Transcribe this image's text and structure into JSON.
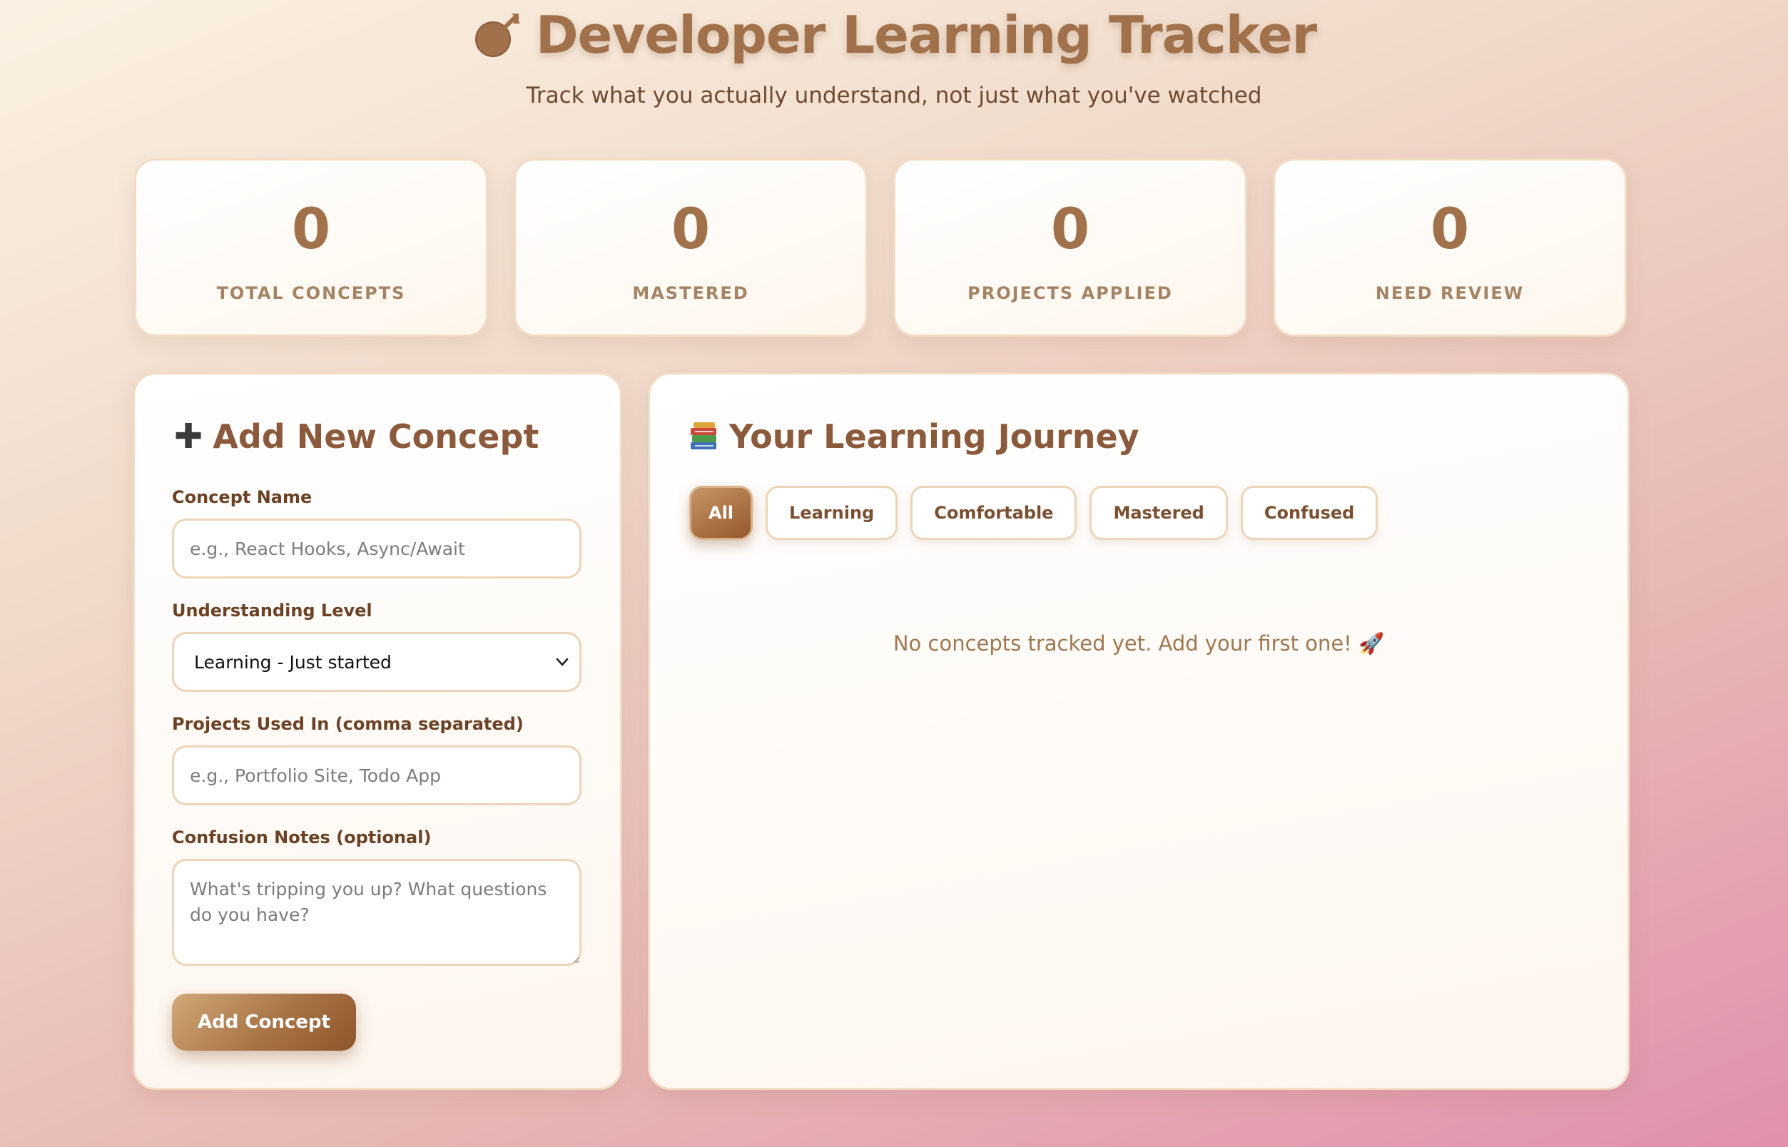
{
  "header": {
    "title": "Developer Learning Tracker",
    "subtitle": "Track what you actually understand, not just what you've watched",
    "title_icon": "dart-target-icon"
  },
  "stats": [
    {
      "value": "0",
      "label": "TOTAL CONCEPTS"
    },
    {
      "value": "0",
      "label": "MASTERED"
    },
    {
      "value": "0",
      "label": "PROJECTS APPLIED"
    },
    {
      "value": "0",
      "label": "NEED REVIEW"
    }
  ],
  "add_form": {
    "title": "Add New Concept",
    "icon": "plus-icon",
    "concept_name_label": "Concept Name",
    "concept_name_placeholder": "e.g., React Hooks, Async/Await",
    "concept_name_value": "",
    "level_label": "Understanding Level",
    "level_selected": "Learning - Just started",
    "projects_label": "Projects Used In (comma separated)",
    "projects_placeholder": "e.g., Portfolio Site, Todo App",
    "projects_value": "",
    "notes_label": "Confusion Notes (optional)",
    "notes_placeholder": "What's tripping you up? What questions do you have?",
    "notes_value": "",
    "submit_label": "Add Concept"
  },
  "journey": {
    "title": "Your Learning Journey",
    "icon": "books-icon",
    "filters": [
      {
        "label": "All",
        "active": true
      },
      {
        "label": "Learning",
        "active": false
      },
      {
        "label": "Comfortable",
        "active": false
      },
      {
        "label": "Mastered",
        "active": false
      },
      {
        "label": "Confused",
        "active": false
      }
    ],
    "empty_message": "No concepts tracked yet. Add your first one! 🚀"
  },
  "colors": {
    "accent": "#a0714a",
    "accent_dark": "#8b5a3c",
    "card_border": "#f2dcc6",
    "background_start": "#fbf1e2",
    "background_end": "#e190ae"
  }
}
